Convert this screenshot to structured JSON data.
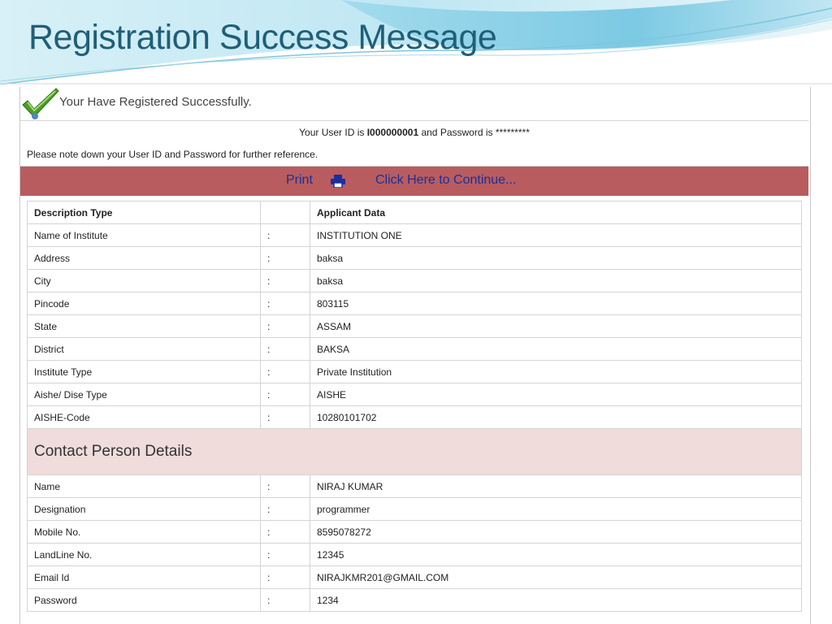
{
  "slide": {
    "title": "Registration Success Message"
  },
  "success": {
    "message": "Your Have Registered Successfully.",
    "userid_prefix": "Your User ID is ",
    "userid_value": "I000000001",
    "password_text": " and Password is *********",
    "note": "Please note down your User ID and Password for further reference."
  },
  "actions": {
    "print_label": "Print",
    "continue_label": "Click Here to Continue..."
  },
  "icons": {
    "success": "check-icon",
    "print": "printer-icon"
  },
  "colors": {
    "action_bar": "#b85c5f",
    "link": "#1a2f9e",
    "section_bg": "#efdcdb",
    "title": "#1f5f78"
  },
  "table": {
    "header": {
      "col1": "Description Type",
      "col2": "",
      "col3": "Applicant Data"
    },
    "rows": [
      {
        "label": "Name of Institute",
        "sep": ":",
        "value": "INSTITUTION ONE"
      },
      {
        "label": "Address",
        "sep": ":",
        "value": "baksa"
      },
      {
        "label": "City",
        "sep": ":",
        "value": "baksa"
      },
      {
        "label": "Pincode",
        "sep": ":",
        "value": "803115"
      },
      {
        "label": "State",
        "sep": ":",
        "value": "ASSAM"
      },
      {
        "label": "District",
        "sep": ":",
        "value": "BAKSA"
      },
      {
        "label": "Institute Type",
        "sep": ":",
        "value": "Private Institution"
      },
      {
        "label": "Aishe/ Dise Type",
        "sep": ":",
        "value": "AISHE"
      },
      {
        "label": "AISHE-Code",
        "sep": ":",
        "value": "10280101702"
      }
    ],
    "section_title": "Contact Person Details",
    "contact_rows": [
      {
        "label": "Name",
        "sep": ":",
        "value": "NIRAJ KUMAR"
      },
      {
        "label": "Designation",
        "sep": ":",
        "value": "programmer"
      },
      {
        "label": "Mobile No.",
        "sep": ":",
        "value": "8595078272"
      },
      {
        "label": "LandLine No.",
        "sep": ":",
        "value": "12345"
      },
      {
        "label": "Email Id",
        "sep": ":",
        "value": "NIRAJKMR201@GMAIL.COM"
      },
      {
        "label": "Password",
        "sep": ":",
        "value": "1234"
      }
    ]
  }
}
